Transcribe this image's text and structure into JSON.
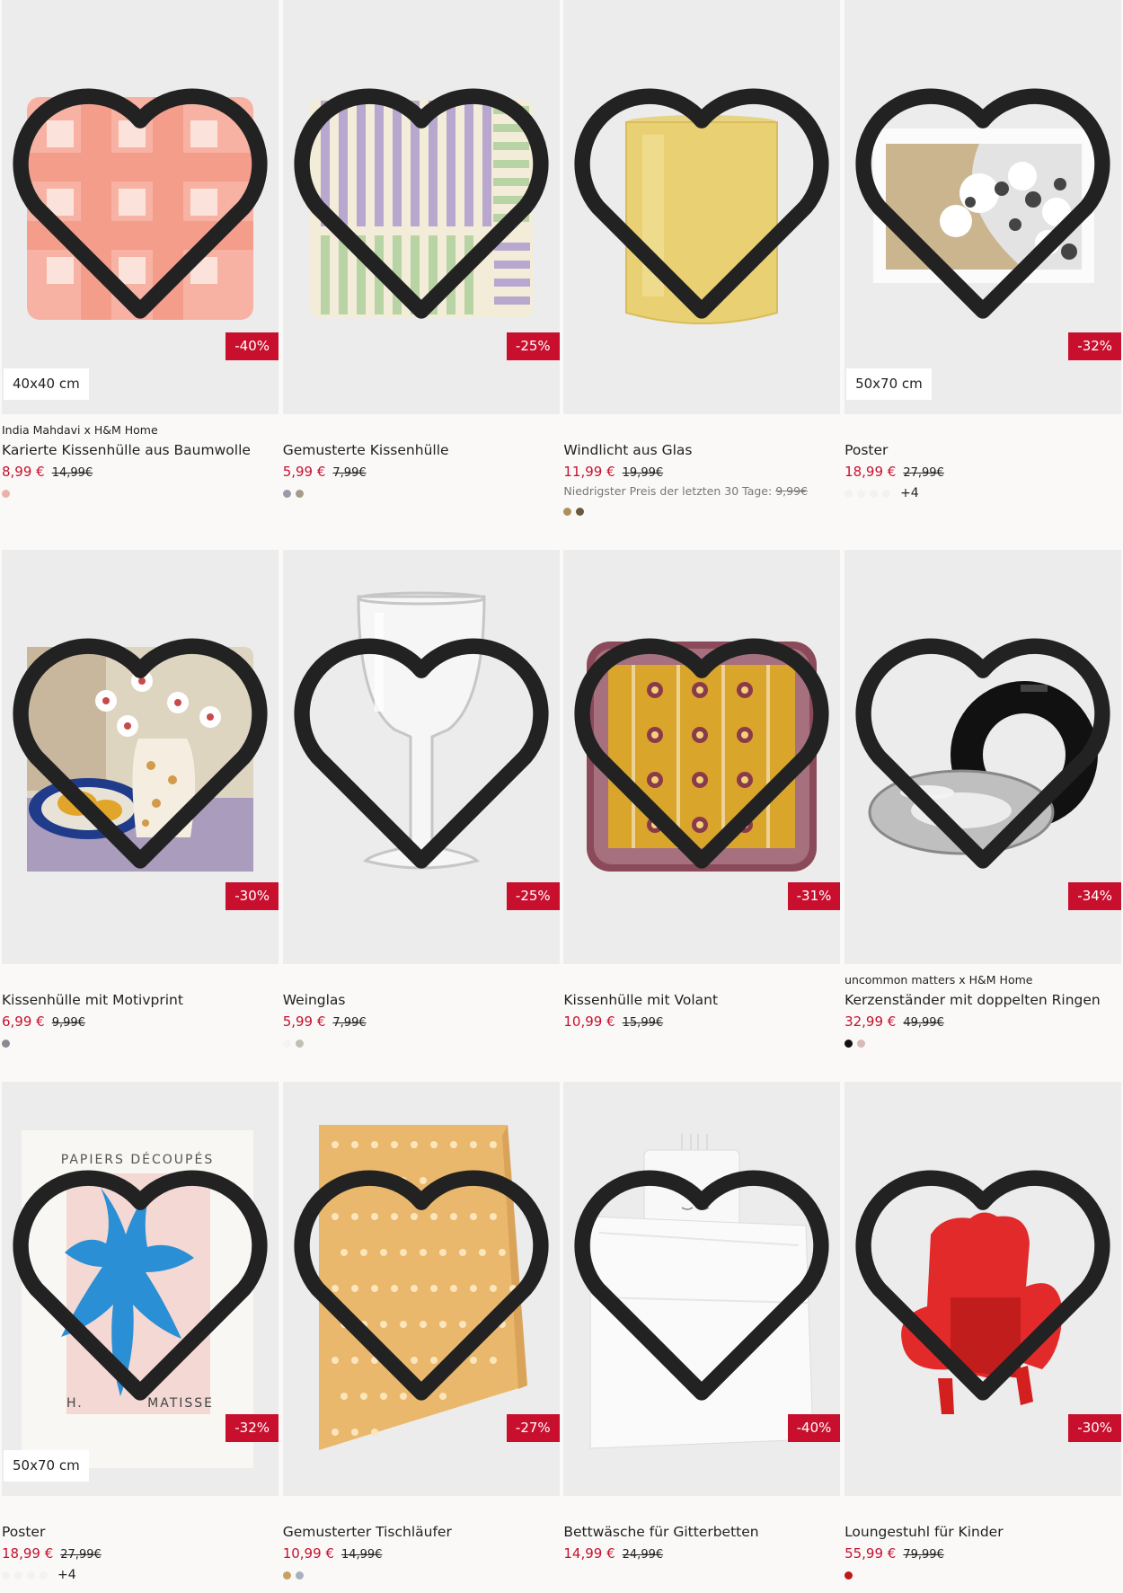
{
  "products": [
    {
      "brand": "India Mahdavi x H&M Home",
      "name": "Karierte Kissenhülle aus Baumwolle",
      "price": "8,99 €",
      "old_price": "14,99€",
      "discount": "-40%",
      "size_tag": "40x40 cm",
      "lowest": "",
      "lowest_old": "",
      "swatches": [
        "#e8b4a8"
      ],
      "more": "",
      "icon": "gingham-pillow-image"
    },
    {
      "brand": "",
      "name": "Gemusterte Kissenhülle",
      "price": "5,99 €",
      "old_price": "7,99€",
      "discount": "-25%",
      "size_tag": "",
      "lowest": "",
      "lowest_old": "",
      "swatches": [
        "#9a9aa8",
        "#a89b87"
      ],
      "more": "",
      "icon": "striped-pillow-image"
    },
    {
      "brand": "",
      "name": "Windlicht aus Glas",
      "price": "11,99 €",
      "old_price": "19,99€",
      "discount": "",
      "size_tag": "",
      "lowest": "Niedrigster Preis der letzten 30 Tage:",
      "lowest_old": "9,99€",
      "swatches": [
        "#b0905a",
        "#6b5a3a"
      ],
      "more": "",
      "icon": "glass-candle-holder-image"
    },
    {
      "brand": "",
      "name": "Poster",
      "price": "18,99 €",
      "old_price": "27,99€",
      "discount": "-32%",
      "size_tag": "50x70 cm",
      "lowest": "",
      "lowest_old": "",
      "swatches": [
        "#f4f4f4",
        "#f4f4f4",
        "#f4f4f4",
        "#f4f4f4"
      ],
      "more": "+4",
      "icon": "flower-poster-image"
    },
    {
      "brand": "",
      "name": "Kissenhülle mit Motivprint",
      "price": "6,99 €",
      "old_price": "9,99€",
      "discount": "-30%",
      "size_tag": "",
      "lowest": "",
      "lowest_old": "",
      "swatches": [
        "#8a8a92"
      ],
      "more": "",
      "icon": "motif-pillow-image"
    },
    {
      "brand": "",
      "name": "Weinglas",
      "price": "5,99 €",
      "old_price": "7,99€",
      "discount": "-25%",
      "size_tag": "",
      "lowest": "",
      "lowest_old": "",
      "swatches": [
        "#f4f4f4",
        "#c0c0b8"
      ],
      "more": "",
      "icon": "wine-glass-image"
    },
    {
      "brand": "",
      "name": "Kissenhülle mit Volant",
      "price": "10,99 €",
      "old_price": "15,99€",
      "discount": "-31%",
      "size_tag": "",
      "lowest": "",
      "lowest_old": "",
      "swatches": [],
      "more": "",
      "icon": "ruffle-pillow-image"
    },
    {
      "brand": "uncommon matters x H&M Home",
      "name": "Kerzenständer mit doppelten Ringen",
      "price": "32,99 €",
      "old_price": "49,99€",
      "discount": "-34%",
      "size_tag": "",
      "lowest": "",
      "lowest_old": "",
      "swatches": [
        "#111111",
        "#d8b8b8"
      ],
      "more": "",
      "icon": "ring-candle-holder-image"
    },
    {
      "brand": "",
      "name": "Poster",
      "price": "18,99 €",
      "old_price": "27,99€",
      "discount": "-32%",
      "size_tag": "50x70 cm",
      "lowest": "",
      "lowest_old": "",
      "swatches": [
        "#f4f4f4",
        "#f4f4f4",
        "#f4f4f4",
        "#f4f4f4"
      ],
      "more": "+4",
      "icon": "matisse-poster-image"
    },
    {
      "brand": "",
      "name": "Gemusterter Tischläufer",
      "price": "10,99 €",
      "old_price": "14,99€",
      "discount": "-27%",
      "size_tag": "",
      "lowest": "",
      "lowest_old": "",
      "swatches": [
        "#c8a060",
        "#a8b0c0"
      ],
      "more": "",
      "icon": "table-runner-image"
    },
    {
      "brand": "",
      "name": "Bettwäsche für Gitterbetten",
      "price": "14,99 €",
      "old_price": "24,99€",
      "discount": "-40%",
      "size_tag": "",
      "lowest": "",
      "lowest_old": "",
      "swatches": [],
      "more": "",
      "icon": "crib-bedding-image"
    },
    {
      "brand": "",
      "name": "Loungestuhl für Kinder",
      "price": "55,99 €",
      "old_price": "79,99€",
      "discount": "-30%",
      "size_tag": "",
      "lowest": "",
      "lowest_old": "",
      "swatches": [
        "#c01818"
      ],
      "more": "",
      "icon": "kids-chair-image"
    }
  ],
  "colors": {
    "sale": "#c8102e",
    "background": "#faf9f8",
    "image_bg": "#eeeeee"
  }
}
